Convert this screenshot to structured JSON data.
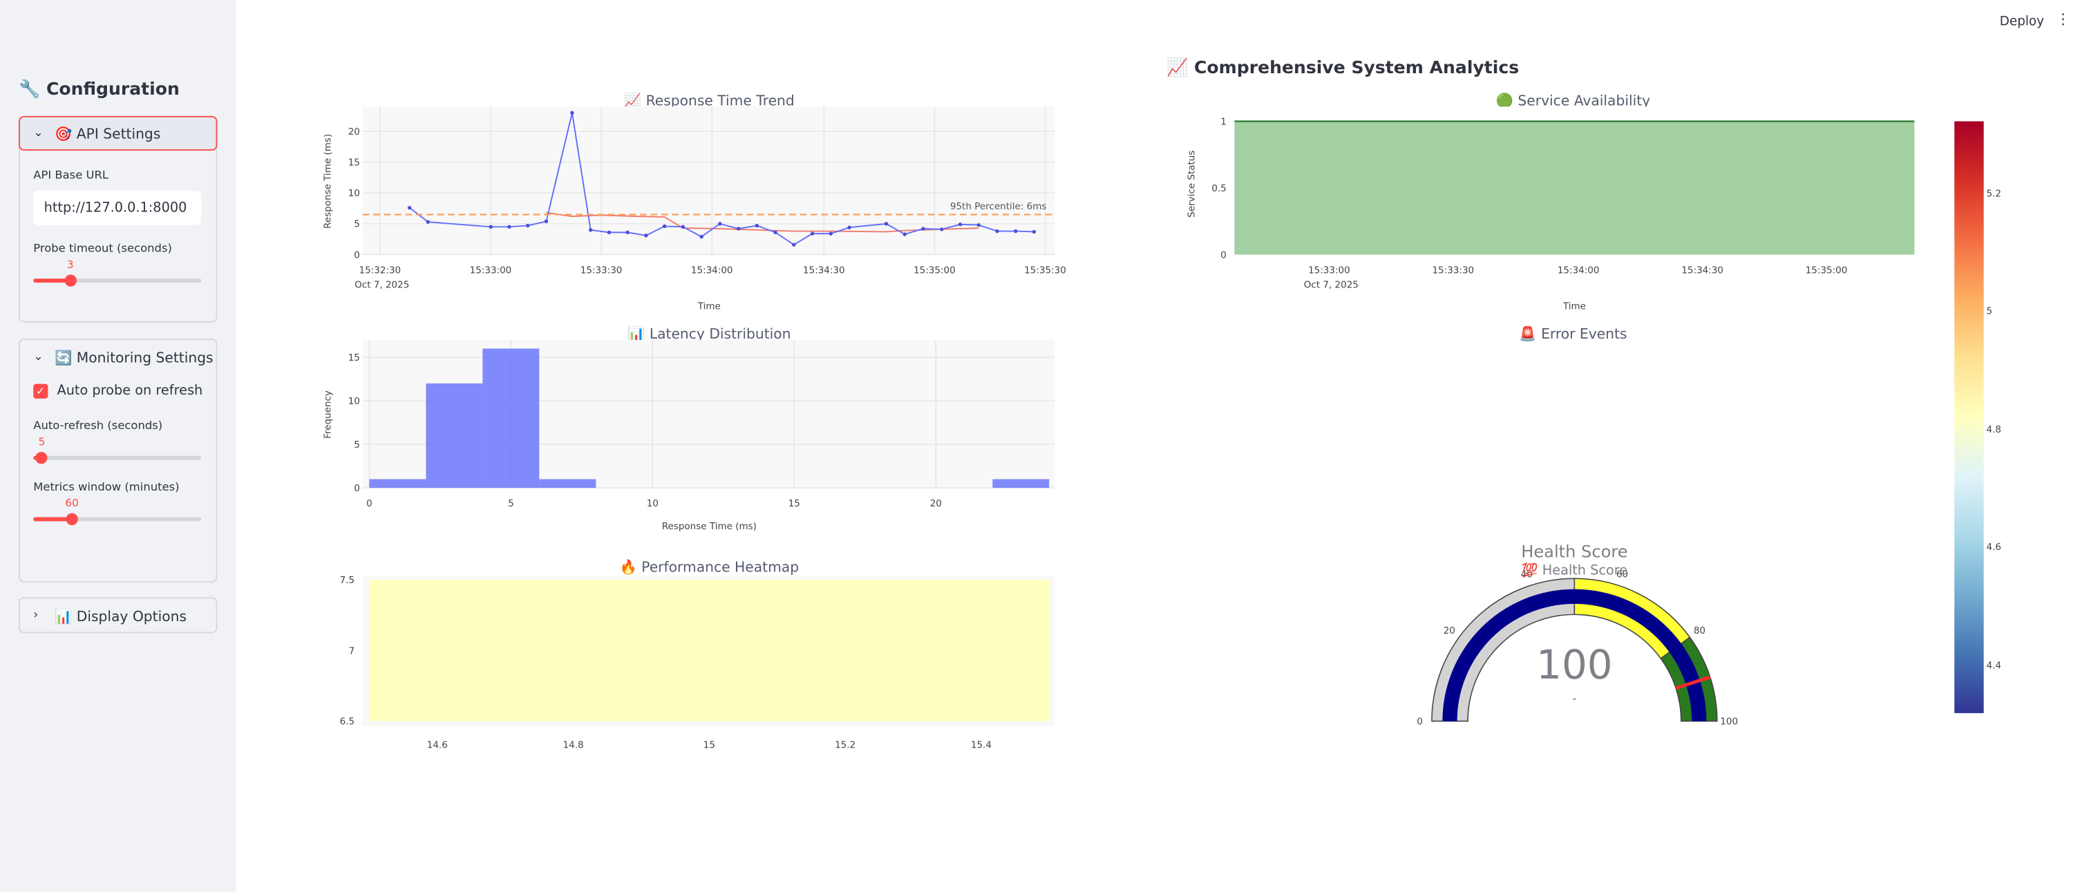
{
  "header": {
    "deploy_label": "Deploy",
    "menu_icon": "kebab-icon"
  },
  "sidebar": {
    "title": "🔧 Configuration",
    "api_settings": {
      "header": "🎯 API Settings",
      "base_url_label": "API Base URL",
      "base_url_value": "http://127.0.0.1:8000",
      "timeout_label": "Probe timeout (seconds)",
      "timeout_value": "3",
      "timeout_fraction": 0.22
    },
    "monitoring": {
      "header": "🔄 Monitoring Settings",
      "auto_probe_label": "Auto probe on refresh",
      "auto_probe_checked": true,
      "refresh_label": "Auto-refresh (seconds)",
      "refresh_value": "5",
      "refresh_fraction": 0.05,
      "window_label": "Metrics window (minutes)",
      "window_value": "60",
      "window_fraction": 0.23
    },
    "display": {
      "header": "📊 Display Options"
    }
  },
  "main": {
    "title": "📈 Comprehensive System Analytics",
    "response_title": "📈 Response Time Trend",
    "latency_title": "📊 Latency Distribution",
    "heatmap_title": "🔥 Performance Heatmap",
    "availability_title": "🟢 Service Availability",
    "errors_title": "🚨 Error Events"
  },
  "chart_data": [
    {
      "type": "line",
      "title": "📈 Response Time Trend",
      "xlabel": "Time",
      "ylabel": "Response Time (ms)",
      "date_label": "Oct 7, 2025",
      "x_ticks": [
        "15:32:30",
        "15:33:00",
        "15:33:30",
        "15:34:00",
        "15:34:30",
        "15:35:00",
        "15:35:30"
      ],
      "y_ticks": [
        "0",
        "5",
        "10",
        "15",
        "20"
      ],
      "ylim": [
        0,
        24
      ],
      "series": [
        {
          "values": [
            [
              8,
              7.6
            ],
            [
              13,
              5.3
            ],
            [
              30,
              4.5
            ],
            [
              35,
              4.5
            ],
            [
              40,
              4.7
            ],
            [
              45,
              5.4
            ],
            [
              52,
              23
            ],
            [
              57,
              4.0
            ],
            [
              62,
              3.6
            ],
            [
              67,
              3.6
            ],
            [
              72,
              3.1
            ],
            [
              77,
              4.6
            ],
            [
              82,
              4.5
            ],
            [
              87,
              2.9
            ],
            [
              92,
              5.0
            ],
            [
              97,
              4.2
            ],
            [
              102,
              4.7
            ],
            [
              107,
              3.6
            ],
            [
              112,
              1.6
            ],
            [
              117,
              3.4
            ],
            [
              122,
              3.4
            ],
            [
              127,
              4.4
            ],
            [
              137,
              5.0
            ],
            [
              142,
              3.3
            ],
            [
              147,
              4.2
            ],
            [
              152,
              4.1
            ],
            [
              157,
              4.9
            ],
            [
              162,
              4.8
            ],
            [
              167,
              3.8
            ],
            [
              172,
              3.8
            ],
            [
              177,
              3.7
            ]
          ]
        },
        {
          "values": [
            [
              45,
              6.8
            ],
            [
              52,
              6.2
            ],
            [
              60,
              6.4
            ],
            [
              70,
              6.2
            ],
            [
              77,
              6.1
            ],
            [
              82,
              4.3
            ],
            [
              92,
              4.2
            ],
            [
              102,
              4.0
            ],
            [
              112,
              3.8
            ],
            [
              122,
              3.8
            ],
            [
              137,
              3.7
            ],
            [
              142,
              3.9
            ],
            [
              152,
              4.1
            ],
            [
              162,
              4.3
            ]
          ]
        }
      ],
      "threshold": {
        "value": 6.5,
        "label": "95th Percentile: 6ms"
      }
    },
    {
      "type": "bar",
      "title": "📊 Latency Distribution",
      "xlabel": "Response Time (ms)",
      "ylabel": "Frequency",
      "x_ticks": [
        "0",
        "5",
        "10",
        "15",
        "20"
      ],
      "y_ticks": [
        "0",
        "5",
        "10",
        "15"
      ],
      "xlim": [
        0,
        24
      ],
      "ylim": [
        0,
        17
      ],
      "bins": [
        [
          0,
          2,
          1
        ],
        [
          2,
          4,
          12
        ],
        [
          4,
          6,
          16
        ],
        [
          6,
          8,
          1
        ],
        [
          22,
          24,
          1
        ]
      ]
    },
    {
      "type": "heatmap",
      "title": "🔥 Performance Heatmap",
      "x_ticks": [
        "14.6",
        "14.8",
        "15",
        "15.2",
        "15.4"
      ],
      "y_ticks": [
        "6.5",
        "7",
        "7.5"
      ],
      "xlim": [
        14.5,
        15.5
      ],
      "ylim": [
        6.5,
        7.5
      ],
      "value": 4.9
    },
    {
      "type": "area",
      "title": "🟢 Service Availability",
      "xlabel": "Time",
      "ylabel": "Service Status",
      "date_label": "Oct 7, 2025",
      "x_ticks": [
        "15:33:00",
        "15:33:30",
        "15:34:00",
        "15:34:30",
        "15:35:00"
      ],
      "y_ticks": [
        "0",
        "0.5",
        "1"
      ],
      "ylim": [
        0,
        1
      ],
      "value": 1
    },
    {
      "type": "gauge",
      "title": "Health Score",
      "subtitle": "💯 Health Score",
      "value": "100",
      "delta": "-",
      "range": [
        0,
        100
      ],
      "ticks": [
        "0",
        "20",
        "40",
        "60",
        "80",
        "100"
      ],
      "threshold": 90,
      "bands": [
        {
          "from": 0,
          "to": 50,
          "color": "#d3d3d3"
        },
        {
          "from": 50,
          "to": 80,
          "color": "#ffff33"
        },
        {
          "from": 80,
          "to": 100,
          "color": "#2a7a1f"
        }
      ]
    },
    {
      "type": "colorbar",
      "ticks": [
        "4.4",
        "4.6",
        "4.8",
        "5",
        "5.2"
      ]
    }
  ]
}
